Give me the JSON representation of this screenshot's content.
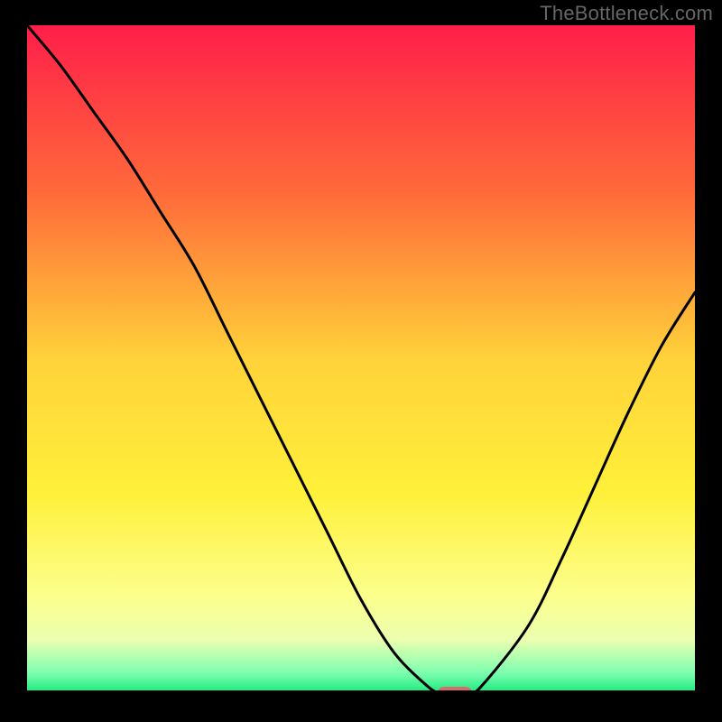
{
  "watermark": {
    "text": "TheBottleneck.com"
  },
  "chart_data": {
    "type": "line",
    "title": "",
    "xlabel": "",
    "ylabel": "",
    "x": [
      0,
      5,
      10,
      15,
      20,
      25,
      30,
      35,
      40,
      45,
      50,
      55,
      60,
      62,
      64,
      66,
      68,
      75,
      80,
      85,
      90,
      95,
      100
    ],
    "y": [
      100,
      94,
      87,
      80,
      72,
      64,
      54,
      44,
      34,
      24,
      14,
      6,
      1,
      0,
      0,
      0,
      1,
      10,
      20,
      31,
      42,
      52,
      60
    ],
    "ylim": [
      0,
      100
    ],
    "xlim": [
      0,
      100
    ],
    "legend": false,
    "grid": false,
    "background_gradient_stops": [
      {
        "pct": 0,
        "color": "#ff1e4a"
      },
      {
        "pct": 25,
        "color": "#ff6a3a"
      },
      {
        "pct": 50,
        "color": "#ffd23a"
      },
      {
        "pct": 70,
        "color": "#fff03a"
      },
      {
        "pct": 85,
        "color": "#fcff8a"
      },
      {
        "pct": 92,
        "color": "#ecffb0"
      },
      {
        "pct": 97,
        "color": "#7dffb0"
      },
      {
        "pct": 100,
        "color": "#18e87a"
      }
    ],
    "marker": {
      "x": 64,
      "y": 0,
      "color": "#d96a6f"
    }
  }
}
